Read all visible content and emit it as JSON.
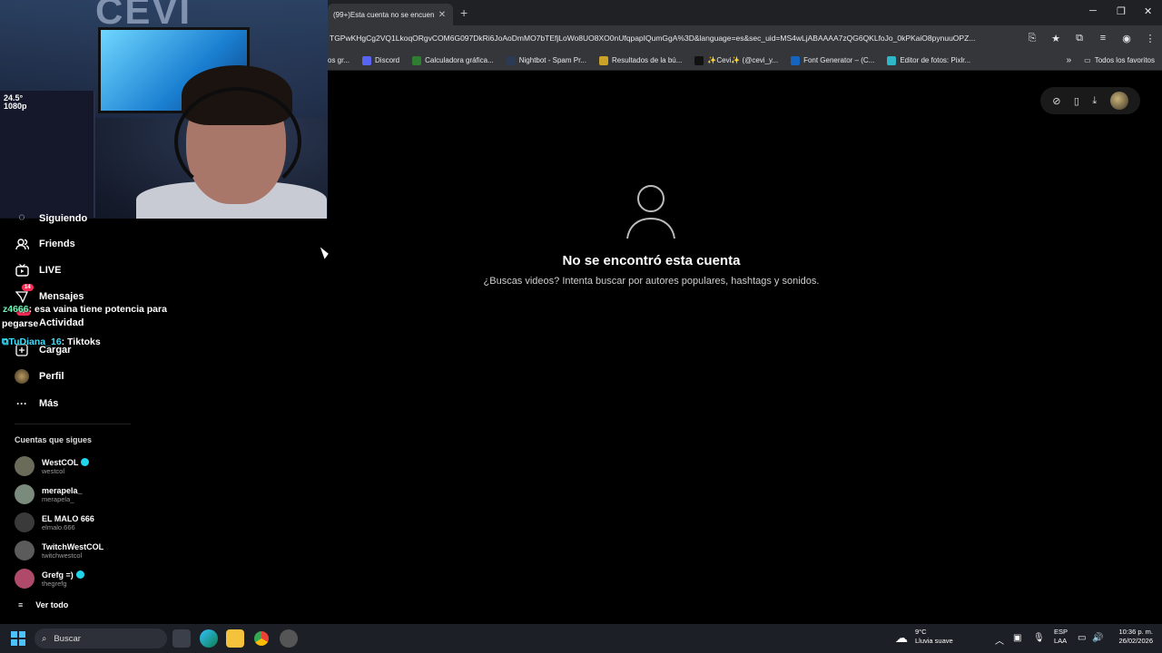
{
  "browser": {
    "tab_title": "(99+)Esta cuenta no se encuen",
    "url": "TGPwKHgCg2VQ1LkoqORgvCOM6G097DkRi6JoAoDmMO7bTEfjLoWo8UO8XO0nUfqpapIQumGgA%3D&language=es&sec_uid=MS4wLjABAAAA7zQG6QKLfoJo_0kPKaiO8pynuuOPZ...",
    "bookmarks": [
      {
        "label": "os gr...",
        "color": "#555"
      },
      {
        "label": "Discord",
        "color": "#5865f2"
      },
      {
        "label": "Calculadora gráfica...",
        "color": "#2e7d32"
      },
      {
        "label": "Nightbot - Spam Pr...",
        "color": "#2b3a55"
      },
      {
        "label": "Resultados de la bú...",
        "color": "#c9a227"
      },
      {
        "label": "✨Cevi✨ (@cevi_y...",
        "color": "#111"
      },
      {
        "label": "Font Generator – (C...",
        "color": "#1565c0"
      },
      {
        "label": "Editor de fotos: Pixlr...",
        "color": "#2fb6c9"
      }
    ],
    "more_bookmarks": "»",
    "all_favorites": "Todos los favoritos"
  },
  "webcam": {
    "badge_fps": "24.5°",
    "badge_res": "1080p",
    "wall_text": "CEVI"
  },
  "sidebar": {
    "partial_item": "Siguiendo",
    "items": [
      {
        "label": "Friends",
        "icon": "friends-icon"
      },
      {
        "label": "LIVE",
        "icon": "live-icon"
      },
      {
        "label": "Mensajes",
        "icon": "messages-icon",
        "badge": "14"
      },
      {
        "label": "Actividad",
        "icon": "activity-icon",
        "badge": "99+"
      },
      {
        "label": "Cargar",
        "icon": "upload-icon"
      },
      {
        "label": "Perfil",
        "icon": "profile-icon"
      },
      {
        "label": "Más",
        "icon": "more-icon"
      }
    ],
    "following_title": "Cuentas que sigues",
    "accounts": [
      {
        "name": "WestCOL",
        "handle": "westcol",
        "verified": true,
        "color": "#6b6b5a"
      },
      {
        "name": "merapela_",
        "handle": "merapela_",
        "verified": false,
        "color": "#7a8a7d"
      },
      {
        "name": "EL MALO 666",
        "handle": "elmalo.666",
        "verified": false,
        "color": "#3a3a3a"
      },
      {
        "name": "TwitchWestCOL",
        "handle": "twitchwestcol",
        "verified": false,
        "color": "#5b5b5b"
      },
      {
        "name": "Grefg =)",
        "handle": "thegrefg",
        "verified": true,
        "color": "#b04a6a"
      }
    ],
    "see_all": "Ver todo"
  },
  "chat": [
    {
      "user": "z4666",
      "message": ": esa vaina tiene potencia para"
    },
    {
      "user": "pegarse",
      "message": ""
    },
    {
      "user": "TuDiana_16",
      "message": ": Tiktoks"
    }
  ],
  "main": {
    "empty_title": "No se encontró esta cuenta",
    "empty_subtitle": "¿Buscas videos? Intenta buscar por autores populares, hashtags y sonidos."
  },
  "taskbar": {
    "search_placeholder": "Buscar",
    "weather_temp": "9°C",
    "weather_desc": "Lluvia suave",
    "lang_top": "ESP",
    "lang_bottom": "LAA",
    "time": "10:36 p. m.",
    "date": "26/02/2026"
  }
}
